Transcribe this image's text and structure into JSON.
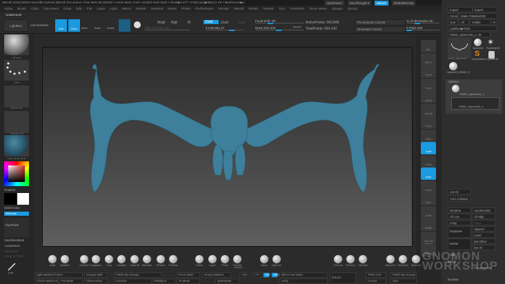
{
  "titlebar": {
    "text": "ZBrush 2018 [VERG-Guerrilla Games]   ZBrush Document    • Free Mem 56.293GB • Active Mem 1745 • Scratch Disk 1020 • Timer▶0.477 • PolyCount▶568.21 KP • MeshCount▶1"
  },
  "topright": {
    "quicksave": "QuickSave",
    "seethrough": "See-through 0",
    "menus": "Menus",
    "script": "DefaultZScript"
  },
  "menu": [
    "Alpha",
    "Brush",
    "Color",
    "Document",
    "Draw",
    "Edit",
    "File",
    "Layer",
    "Light",
    "Macro",
    "Marker",
    "Material",
    "Movie",
    "Picker",
    "Preferences",
    "Render",
    "Stencil",
    "Stroke",
    "Texture",
    "Tool",
    "Transform",
    "Zoom Menu",
    "Zplugin",
    "Zscript"
  ],
  "tool_label": "SnakeHook",
  "shelf": {
    "lightbox": "LightBox",
    "live_boolean": "Live Boolean",
    "edit": "Edit",
    "draw": "Draw",
    "move": "Move",
    "scale": "Scale",
    "rotate": "Rotate",
    "mrgb": "Mrgb",
    "rgb": "Rgb",
    "m": "M",
    "rgb_intensity": "Rgb Intensity 100",
    "zadd": "Zadd",
    "zsub": "Zsub",
    "zcut": "Zcut",
    "z_intensity": "Z Intensity 37",
    "focal_shift": "Focal Shift -39",
    "draw_size": "Draw Size 204",
    "dynamic": "Dynamic",
    "active_points": "ActivePoints: 560,848",
    "total_points": "TotalPoints: 691,410",
    "preprocess": "Pre-process Current",
    "decimate": "Decimate Current",
    "pct_decimation": "% of decimation 20",
    "k_polys": "k Polys 200"
  },
  "lefttray": {
    "brush": "hPolish",
    "stroke": "Dots",
    "alpha": "Alpha Off",
    "texture": "Texture Off",
    "material": "matt_dirty_blue",
    "gradient": "Gradient",
    "switchcolor": "SwitchColor",
    "alternate": "Alternate",
    "claypolish": "ClayPolish",
    "backface": "BackfaceMask",
    "lazymouse": "LazyMouse",
    "backtrack": "Backtrack",
    "snaptotrack": "Snap To Track",
    "line": "Line"
  },
  "rightshelf": [
    "Bpr",
    "SPix 3",
    "Scroll",
    "Zoom",
    "Actual",
    "AAHalf",
    "Persp",
    "Floor",
    "Local",
    "L.Sym",
    "Gxyz",
    "Frame",
    "Move",
    "Scale",
    "Rotate",
    "Line Fill PolyF",
    "Transp"
  ],
  "righttray": {
    "import": "Import",
    "export": "Export",
    "clone": "Clone",
    "make_polymesh": "Make PolyMesh3D",
    "goz": "GoZ",
    "all": "All",
    "visible": "Visible",
    "r": "R",
    "lightbox_tools": "Lightbox▶Tools",
    "current_tool": "PM3D_Sphere3D_2. 49",
    "tools": [
      "PM3D_Sphere3D",
      "Sphere3D",
      "PolyMesh3D",
      "SimpleBrush",
      "Cylinder3D",
      "Sphere3D_1",
      "PM3D_S"
    ],
    "subtool_title": "Subtool",
    "subtools": [
      "PM3D_Sphere3D_1",
      "PM3D_Sphere3D_2"
    ],
    "list_all": "List All",
    "auto_collapse": "Auto Collapse",
    "rename": "Rename",
    "autoreorder": "AutoReorder",
    "all_low": "All Low",
    "all_high": "All High",
    "copy": "Copy",
    "paste": "Paste",
    "duplicate": "Duplicate",
    "append": "Append",
    "insert": "Insert",
    "delete": "Delete",
    "del_other": "Del Other",
    "del_all": "Del All",
    "split": "Split",
    "merge": "Merge",
    "merge_similar": "MergeSimilar",
    "boolean": "Boolean"
  },
  "bottom": {
    "brushes": [
      "Inflat",
      "SnakeH",
      "SnakeH",
      "Dosplace",
      "Clay",
      "ClayBuil",
      "ClayTub",
      "ZModele",
      "hPolish",
      "TrimDyr",
      "Polish",
      "Layer",
      "Pinch",
      "TrimAdr",
      "Move",
      "ClipCurv",
      "TrimLas",
      "TrimCur",
      "TrimRec",
      "SliceCirc",
      "SliceRec",
      "SliceCur"
    ],
    "split_masked": "Split Masked Points",
    "groups_split": "Groups Split",
    "check_mesh": "Check Mesh Int",
    "fix_mesh": "Fix Mesh",
    "close_holes": "Close Holes",
    "polish_by_groups": "Polish By Groups",
    "colorize": "Colorize",
    "fillobject": "FillObject",
    "from_mesh": "From Mesh",
    "to_mesh": "To Mesh",
    "group_masked": "Group Masked",
    "syspalette": "SysPalette",
    "xyz": ">Y<",
    "sym_z": ">Z<",
    "sym_m": ">M<",
    "mirror_weld": "Mirror And Weld",
    "unify": "Unify",
    "extract": "Extract",
    "thick": "Thick 0.02",
    "accept": "Accept",
    "polish_groups2": "Polish By Groups",
    "size": "Size",
    "dynamic": "Dynamic",
    "xx": ">X<"
  },
  "watermark": "GNOMON WORKSHOP",
  "colors": {
    "accent": "#1a9ae0",
    "model": "#3e7f9b"
  }
}
